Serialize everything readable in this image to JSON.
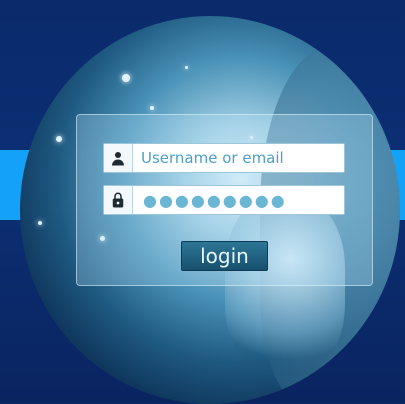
{
  "login_form": {
    "username_placeholder": "Username or email",
    "password_mask": "●●●●●●●●●",
    "login_button_label": "login"
  }
}
